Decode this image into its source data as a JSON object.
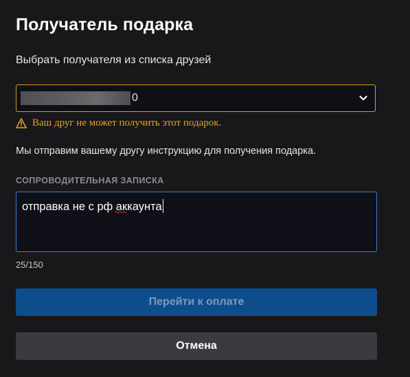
{
  "dialog": {
    "title": "Получатель подарка",
    "subtitle": "Выбрать получателя из списка друзей"
  },
  "recipient_select": {
    "visible_suffix": "0",
    "icon": "chevron-down-icon"
  },
  "warning": {
    "icon": "warning-triangle-icon",
    "text": "Ваш друг не может получить этот подарок.",
    "color": "#e8a21b"
  },
  "info_text": "Мы отправим вашему другу инструкцию для получения подарка.",
  "note": {
    "label": "СОПРОВОДИТЕЛЬНАЯ ЗАПИСКА",
    "value": "отправка не с рф аккаунта",
    "counter": "25/150"
  },
  "buttons": {
    "pay_label": "Перейти к оплате",
    "cancel_label": "Отмена"
  },
  "colors": {
    "background": "#18181b",
    "accent_blue": "#0e4d8c",
    "focus_border": "#3d7fd0",
    "warning_border": "#d9a21e"
  }
}
